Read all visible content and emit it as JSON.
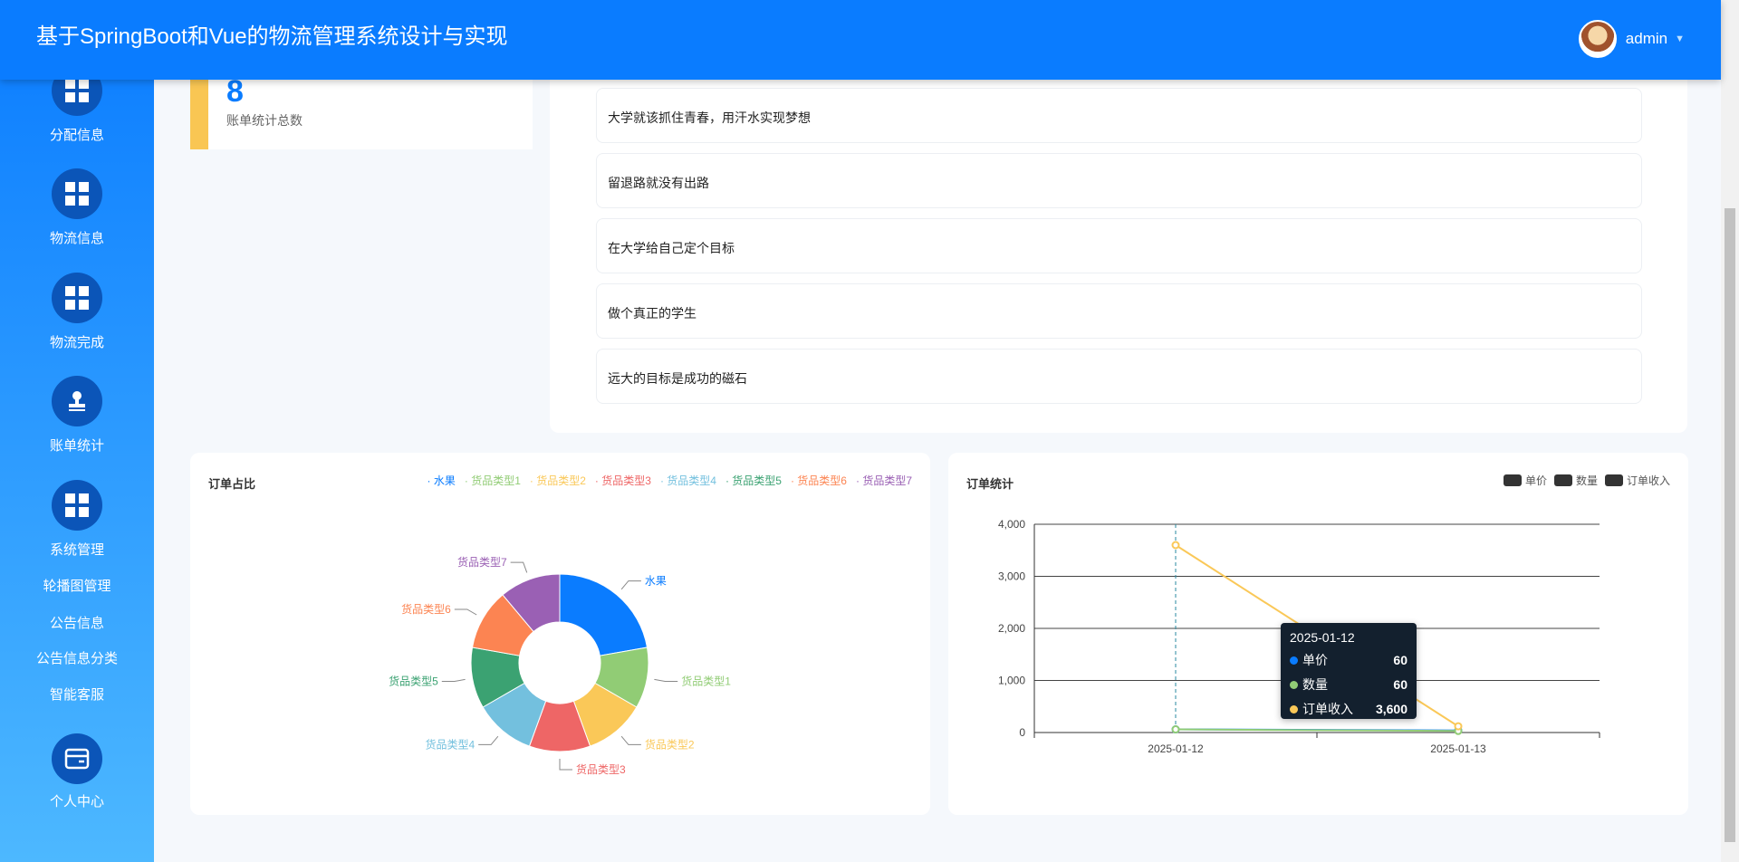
{
  "header": {
    "title": "基于SpringBoot和Vue的物流管理系统设计与实现",
    "username": "admin"
  },
  "sidebar": {
    "items": [
      {
        "label": "分配信息",
        "icon": "grid-icon"
      },
      {
        "label": "物流信息",
        "icon": "grid-icon"
      },
      {
        "label": "物流完成",
        "icon": "grid-icon"
      },
      {
        "label": "账单统计",
        "icon": "stamp-icon"
      },
      {
        "label": "系统管理",
        "icon": "grid-icon"
      },
      {
        "label": "个人中心",
        "icon": "card-icon"
      }
    ],
    "sub_items": [
      "轮播图管理",
      "公告信息",
      "公告信息分类",
      "智能客服"
    ]
  },
  "stat": {
    "value": "8",
    "label": "账单统计总数",
    "accent": "#f9c653"
  },
  "notices": [
    "大学就该抓住青春，用汗水实现梦想",
    "留退路就没有出路",
    "在大学给自己定个目标",
    "做个真正的学生",
    "远大的目标是成功的磁石"
  ],
  "chart_data": [
    {
      "type": "pie",
      "title": "订单占比",
      "donut": true,
      "legend_position": "top-right",
      "categories": [
        "水果",
        "货品类型1",
        "货品类型2",
        "货品类型3",
        "货品类型4",
        "货品类型5",
        "货品类型6",
        "货品类型7"
      ],
      "values": [
        2,
        1,
        1,
        1,
        1,
        1,
        1,
        1
      ],
      "colors": [
        "#0a7cff",
        "#91cc75",
        "#fac858",
        "#ee6666",
        "#73c0de",
        "#3ba272",
        "#fc8452",
        "#9a60b4"
      ]
    },
    {
      "type": "line",
      "title": "订单统计",
      "legend_position": "top-right",
      "grid": true,
      "x": [
        "2025-01-12",
        "2025-01-13"
      ],
      "ylim": [
        0,
        4000
      ],
      "yticks": [
        "0",
        "1,000",
        "2,000",
        "3,000",
        "4,000"
      ],
      "ytick_values": [
        0,
        1000,
        2000,
        3000,
        4000
      ],
      "series": [
        {
          "name": "单价",
          "values": [
            60,
            40
          ],
          "color": "#0a7cff"
        },
        {
          "name": "数量",
          "values": [
            60,
            30
          ],
          "color": "#91cc75"
        },
        {
          "name": "订单收入",
          "values": [
            3600,
            120
          ],
          "color": "#fac858"
        }
      ],
      "tooltip": {
        "date": "2025-01-12",
        "rows": [
          {
            "name": "单价",
            "value": "60"
          },
          {
            "name": "数量",
            "value": "60"
          },
          {
            "name": "订单收入",
            "value": "3,600"
          }
        ]
      }
    }
  ]
}
